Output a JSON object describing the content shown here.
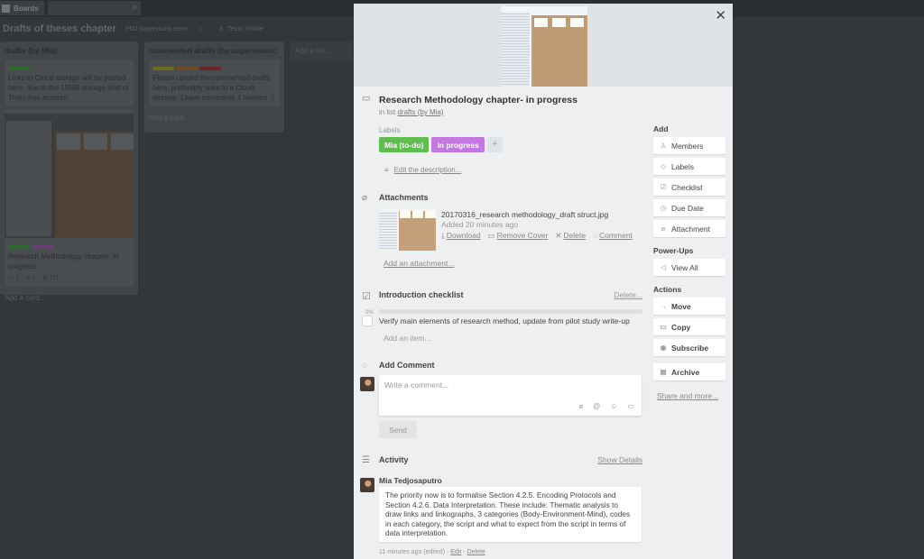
{
  "topbar": {
    "boards_label": "Boards"
  },
  "board": {
    "title": "Drafts of theses chapter",
    "team": "PhD supervisory team",
    "visibility": "Team Visible",
    "add_list": "Add a list..."
  },
  "lists": [
    {
      "title": "drafts (by Mia)",
      "cards": [
        {
          "labels": [
            "#2e8a2e"
          ],
          "text": "Links to Cloud storage will be pasted here, due to the 10MB storage limit of Trello free account."
        },
        {
          "labels": [
            "#2e8a2e",
            "#7a3a8a"
          ],
          "text": "Research Methodology chapter- in progress",
          "badges": {
            "comments": "1",
            "attachments": "1",
            "checklist": "0/1"
          }
        }
      ],
      "add_card": "Add a card..."
    },
    {
      "title": "commented drafts (by supervisors)",
      "cards": [
        {
          "labels": [
            "#8a8a1a",
            "#8a5a2a",
            "#8a2a2a"
          ],
          "text": "Please upload the commented drafts here, preferably links to a Cloud storage. Leave comments if needed :)"
        }
      ],
      "add_card": "Add a card..."
    }
  ],
  "modal": {
    "title": "Research Methodology chapter- in progress",
    "in_list_prefix": "in list",
    "in_list_name": "drafts (by Mia)",
    "labels_caption": "Labels",
    "labels": [
      {
        "text": "Mia (to-do)",
        "color": "#61bd4f"
      },
      {
        "text": "in progress",
        "color": "#c377e0"
      }
    ],
    "add_label": "+",
    "edit_description": "Edit the description...",
    "attachments": {
      "heading": "Attachments",
      "file_name": "20170316_research methodology_draft struct.jpg",
      "added": "Added 20 minutes ago",
      "actions": [
        {
          "icon": "download-icon",
          "glyph": "⤓",
          "label": "Download"
        },
        {
          "icon": "remove-cover-icon",
          "glyph": "▭",
          "label": "Remove Cover"
        },
        {
          "icon": "delete-icon",
          "glyph": "✕",
          "label": "Delete"
        },
        {
          "icon": "comment-icon",
          "glyph": "◌",
          "label": "Comment"
        }
      ],
      "add": "Add an attachment..."
    },
    "checklist": {
      "heading": "Introduction checklist",
      "delete": "Delete...",
      "progress_pct": "0%",
      "progress": 0,
      "items": [
        {
          "text": "Verify main elements of research method, update from pilot study write-up",
          "checked": false
        }
      ],
      "add_item": "Add an item..."
    },
    "add_comment": {
      "heading": "Add Comment",
      "placeholder": "Write a comment...",
      "send": "Send"
    },
    "activity": {
      "heading": "Activity",
      "show_details": "Show Details",
      "author": "Mia Tedjosaputro",
      "text": "The priority now is to formalise Section 4.2.5. Encoding Protocols and Section 4.2.6. Data Interpretation. These include: Thematic analysis to draw links and linkographs, 3 categories (Body-Environment-Mind), codes in each category, the script and what to expect from the script in terms of data interpretation.",
      "meta": "11 minutes ago (edited) -",
      "edit": "Edit",
      "delete": "Delete",
      "sep": "-"
    },
    "sidebar": {
      "add_heading": "Add",
      "add_buttons": [
        {
          "icon": "members-icon",
          "glyph": "♙",
          "label": "Members"
        },
        {
          "icon": "labels-icon",
          "glyph": "◇",
          "label": "Labels"
        },
        {
          "icon": "checklist-icon",
          "glyph": "☑",
          "label": "Checklist"
        },
        {
          "icon": "clock-icon",
          "glyph": "◷",
          "label": "Due Date"
        },
        {
          "icon": "paperclip-icon",
          "glyph": "⌀",
          "label": "Attachment"
        }
      ],
      "powerups_heading": "Power-Ups",
      "powerups_button": {
        "icon": "powerup-icon",
        "glyph": "◁",
        "label": "View All"
      },
      "actions_heading": "Actions",
      "action_buttons": [
        {
          "icon": "arrow-right-icon",
          "glyph": "→",
          "label": "Move"
        },
        {
          "icon": "copy-icon",
          "glyph": "▭",
          "label": "Copy"
        },
        {
          "icon": "eye-icon",
          "glyph": "◉",
          "label": "Subscribe"
        },
        {
          "icon": "archive-icon",
          "glyph": "▤",
          "label": "Archive"
        }
      ],
      "share_more": "Share and more..."
    }
  }
}
